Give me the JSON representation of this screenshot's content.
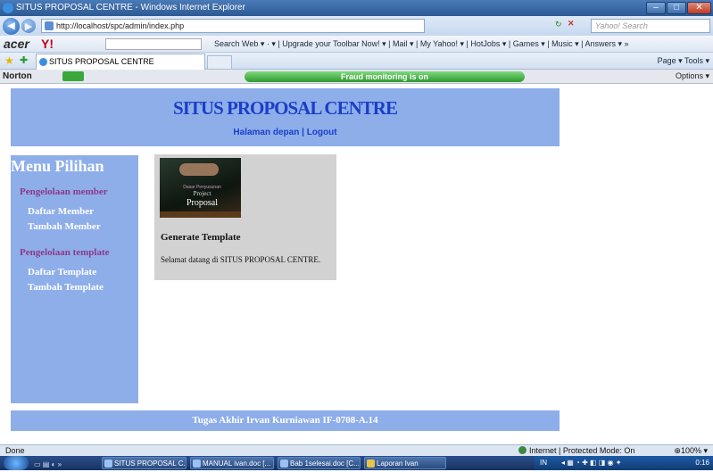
{
  "window": {
    "title": "SITUS PROPOSAL CENTRE - Windows Internet Explorer"
  },
  "address": {
    "url": "http://localhost/spc/admin/index.php",
    "search_placeholder": "Yahoo! Search"
  },
  "yahoo_toolbar": {
    "brand": "acer",
    "items": "Search Web ▾  ·  ▾  |  Upgrade your Toolbar Now! ▾  |  Mail ▾  |  My Yahoo! ▾  |  HotJobs ▾  |  Games ▾  |  Music ▾  |  Answers ▾  »"
  },
  "tabs": {
    "active_label": "SITUS PROPOSAL CENTRE",
    "commands": "Page ▾  Tools ▾"
  },
  "norton": {
    "brand": "Norton",
    "fraud_status": "Fraud monitoring is on",
    "options": "Options ▾"
  },
  "site": {
    "title": "SITUS PROPOSAL CENTRE",
    "nav_home": "Halaman depan",
    "nav_sep": "|",
    "nav_logout": "Logout"
  },
  "sidebar": {
    "title": "Menu Pilihan",
    "section1": "Pengelolaan member",
    "link_daftar_member": "Daftar Member",
    "link_tambah_member": "Tambah Member",
    "section2": "Pengelolaan template",
    "link_daftar_template": "Daftar Template",
    "link_tambah_template": "Tambah Template"
  },
  "content": {
    "book_line1": "Dasar Penyusunan",
    "book_line2": "Project",
    "book_line3": "Proposal",
    "heading": "Generate Template",
    "welcome": "Selamat datang di SITUS PROPOSAL CENTRE."
  },
  "footer": {
    "text": "Tugas Akhir Irvan Kurniawan IF-0708-A.14"
  },
  "statusbar": {
    "left": "Done",
    "zone": "Internet | Protected Mode: On",
    "zoom": "100%"
  },
  "taskbar": {
    "items": [
      "SITUS PROPOSAL C...",
      "MANUAL ivan.doc [...",
      "Bab 1selesai.doc [C...",
      "Laporan Ivan"
    ],
    "tray": "IN",
    "clock": "0:16"
  }
}
